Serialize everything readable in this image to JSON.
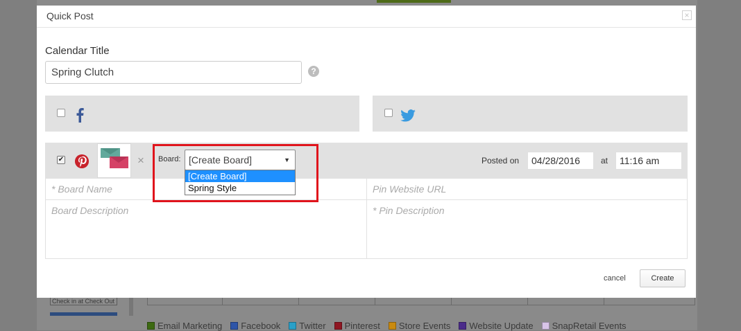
{
  "modal": {
    "title": "Quick Post",
    "close_glyph": "×",
    "calendar_title_label": "Calendar Title",
    "calendar_title_value": "Spring Clutch",
    "help_glyph": "?",
    "facebook_checked": false,
    "twitter_checked": false,
    "pinterest": {
      "checked": true,
      "remove_glyph": "×",
      "board_label": "Board:",
      "board_selected": "[Create Board]",
      "board_options": [
        "[Create Board]",
        "Spring Style"
      ],
      "posted_on_label": "Posted on",
      "date_value": "04/28/2016",
      "at_label": "at",
      "time_value": "11:16 am",
      "board_name_placeholder": "* Board Name",
      "board_description_placeholder": "Board Description",
      "pin_url_placeholder": "Pin Website URL",
      "pin_description_placeholder": "* Pin Description"
    },
    "cancel_label": "cancel",
    "create_label": "Create"
  },
  "background": {
    "button_text": "Check in at Check Out",
    "legend": [
      {
        "label": "Email Marketing",
        "color": "#3d6a12"
      },
      {
        "label": "Facebook",
        "color": "#2e55a8"
      },
      {
        "label": "Twitter",
        "color": "#2aa0c8"
      },
      {
        "label": "Pinterest",
        "color": "#8f1622"
      },
      {
        "label": "Store Events",
        "color": "#c98a10"
      },
      {
        "label": "Website Update",
        "color": "#4b2b8a"
      },
      {
        "label": "SnapRetail Events",
        "color": "#d8c4e8"
      }
    ]
  },
  "colors": {
    "highlight": "#e0141c",
    "pinterest": "#c8232c",
    "facebook": "#3b5998",
    "twitter": "#3a9be0",
    "selected_option": "#1e90ff"
  }
}
